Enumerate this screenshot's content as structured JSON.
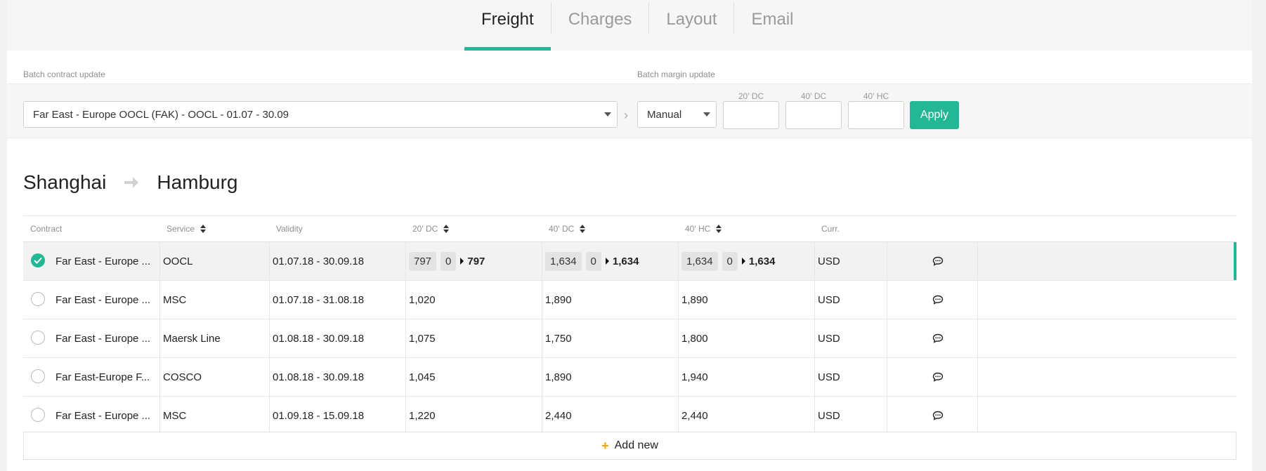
{
  "tabs": [
    {
      "label": "Freight",
      "active": true
    },
    {
      "label": "Charges",
      "active": false
    },
    {
      "label": "Layout",
      "active": false
    },
    {
      "label": "Email",
      "active": false
    }
  ],
  "batch": {
    "contract_label": "Batch contract update",
    "contract_value": "Far East - Europe OOCL (FAK) - OOCL - 01.07 - 30.09",
    "margin_label": "Batch margin update",
    "margin_mode": "Manual",
    "col_20dc": "20' DC",
    "col_40dc": "40' DC",
    "col_40hc": "40' HC",
    "apply_label": "Apply"
  },
  "route": {
    "origin": "Shanghai",
    "destination": "Hamburg"
  },
  "table": {
    "headers": {
      "contract": "Contract",
      "service": "Service",
      "validity": "Validity",
      "dc20": "20' DC",
      "dc40": "40' DC",
      "hc40": "40' HC",
      "curr": "Curr."
    },
    "rows": [
      {
        "contract": "Far East - Europe ...",
        "service": "OOCL",
        "validity": "01.07.18 - 30.09.18",
        "dc20": {
          "base": "797",
          "margin": "0",
          "total": "797"
        },
        "dc40": {
          "base": "1,634",
          "margin": "0",
          "total": "1,634"
        },
        "hc40": {
          "base": "1,634",
          "margin": "0",
          "total": "1,634"
        },
        "curr": "USD",
        "selected": true
      },
      {
        "contract": "Far East - Europe ...",
        "service": "MSC",
        "validity": "01.07.18 - 31.08.18",
        "dc20": "1,020",
        "dc40": "1,890",
        "hc40": "1,890",
        "curr": "USD",
        "selected": false
      },
      {
        "contract": "Far East - Europe ...",
        "service": "Maersk Line",
        "validity": "01.08.18 - 30.09.18",
        "dc20": "1,075",
        "dc40": "1,750",
        "hc40": "1,800",
        "curr": "USD",
        "selected": false
      },
      {
        "contract": "Far East-Europe F...",
        "service": "COSCO",
        "validity": "01.08.18 - 30.09.18",
        "dc20": "1,045",
        "dc40": "1,890",
        "hc40": "1,940",
        "curr": "USD",
        "selected": false
      },
      {
        "contract": "Far East - Europe ...",
        "service": "MSC",
        "validity": "01.09.18 - 15.09.18",
        "dc20": "1,220",
        "dc40": "2,440",
        "hc40": "2,440",
        "curr": "USD",
        "selected": false
      }
    ]
  },
  "add_new_label": "Add new",
  "icons": {
    "check": "check-icon",
    "comment": "comment-icon",
    "plus": "plus-icon",
    "arrow": "arrow-right-icon"
  },
  "colors": {
    "accent": "#23b795",
    "plus": "#f0a500"
  }
}
